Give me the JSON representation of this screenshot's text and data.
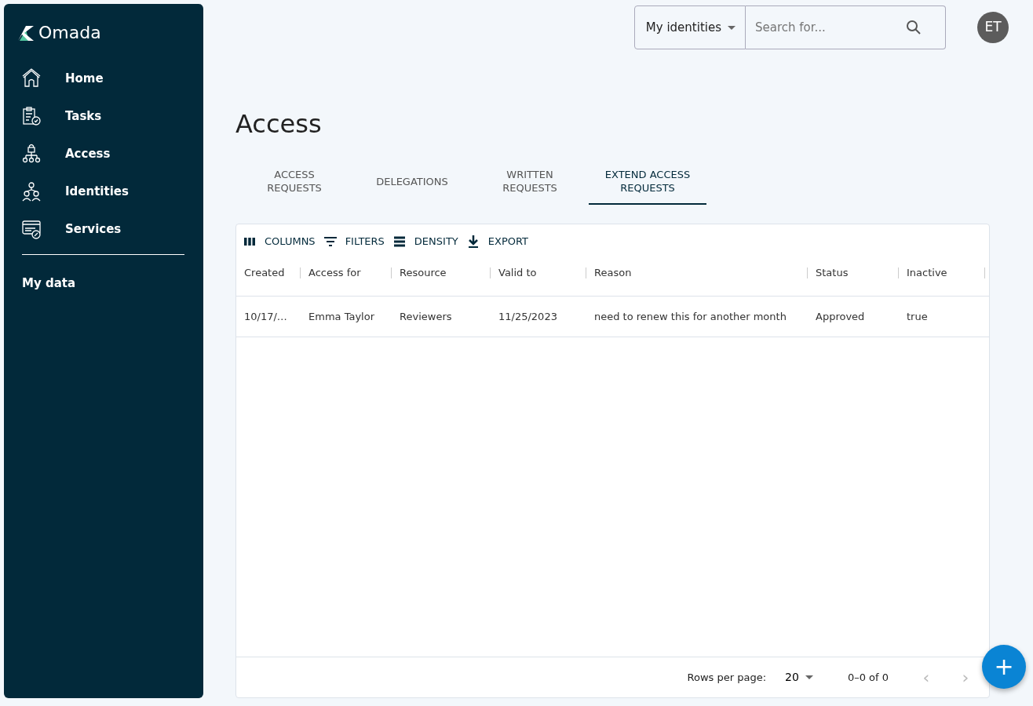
{
  "sidebar": {
    "logo": "Omada",
    "items": [
      {
        "label": "Home",
        "selected": false
      },
      {
        "label": "Tasks",
        "selected": false
      },
      {
        "label": "Access",
        "selected": false
      },
      {
        "label": "Identities",
        "selected": false
      },
      {
        "label": "Services",
        "selected": false
      }
    ],
    "footer_items": [
      {
        "label": "My data"
      }
    ]
  },
  "header": {
    "scope": "My identities",
    "search": {
      "placeholder": "Search for..."
    },
    "avatar": "ET"
  },
  "page": {
    "title": "Access"
  },
  "tabs": [
    {
      "lines": [
        "ACCESS",
        "REQUESTS"
      ],
      "selected": false
    },
    {
      "lines": [
        "DELEGATIONS"
      ],
      "selected": false
    },
    {
      "lines": [
        "WRITTEN",
        "REQUESTS"
      ],
      "selected": false
    },
    {
      "lines": [
        "EXTEND ACCESS",
        "REQUESTS"
      ],
      "selected": true
    }
  ],
  "toolbar": [
    {
      "label": "COLUMNS"
    },
    {
      "label": "FILTERS"
    },
    {
      "label": "DENSITY"
    },
    {
      "label": "EXPORT"
    }
  ],
  "table": {
    "columns": [
      "Created",
      "Access for",
      "Resource",
      "Valid to",
      "Reason",
      "Status",
      "Inactive"
    ],
    "rows": [
      [
        "10/17/…",
        "Emma Taylor",
        "Reviewers",
        "11/25/2023",
        "need to renew this for another month",
        "Approved",
        "true"
      ]
    ]
  },
  "pagination": {
    "rows_label": "Rows per page:",
    "rows_value": "20",
    "range": "0–0 of 0",
    "prev": {
      "label": "‹",
      "disabled": true
    },
    "next": {
      "label": "›",
      "disabled": true
    }
  },
  "fab": {
    "label": "+"
  }
}
